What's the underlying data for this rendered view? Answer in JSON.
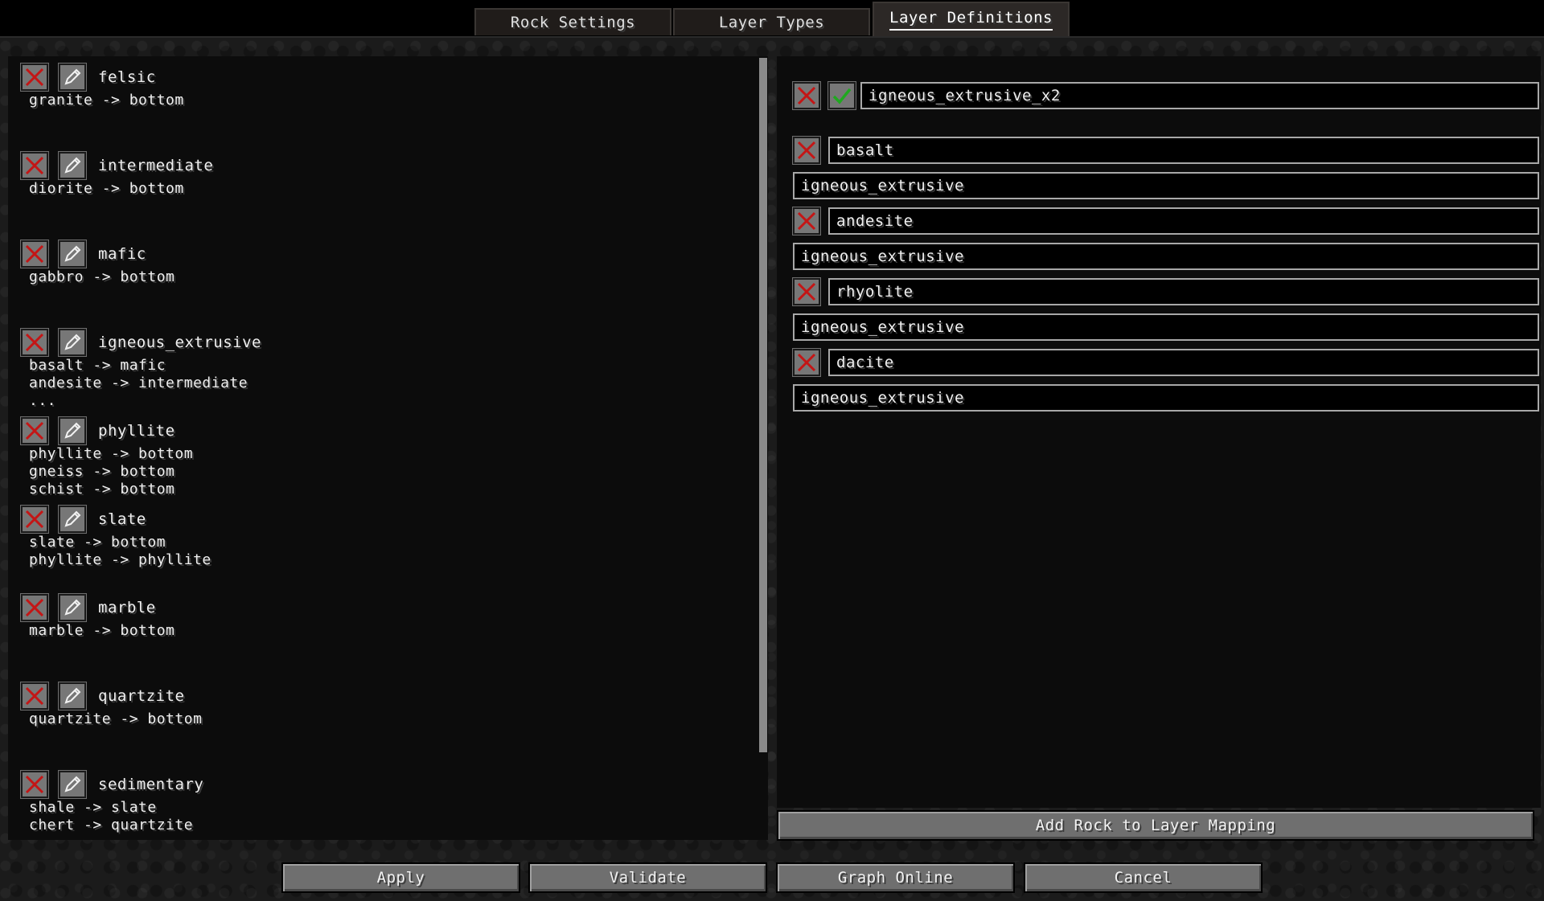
{
  "tabs": [
    {
      "label": "Rock Settings",
      "active": false
    },
    {
      "label": "Layer Types",
      "active": false
    },
    {
      "label": "Layer Definitions",
      "active": true
    }
  ],
  "layers": [
    {
      "name": "felsic",
      "lines": [
        "granite -> bottom"
      ]
    },
    {
      "name": "intermediate",
      "lines": [
        "diorite -> bottom"
      ]
    },
    {
      "name": "mafic",
      "lines": [
        "gabbro -> bottom"
      ]
    },
    {
      "name": "igneous_extrusive",
      "lines": [
        "basalt -> mafic",
        "andesite -> intermediate",
        "..."
      ]
    },
    {
      "name": "phyllite",
      "lines": [
        "phyllite -> bottom",
        "gneiss -> bottom",
        "schist -> bottom"
      ]
    },
    {
      "name": "slate",
      "lines": [
        "slate -> bottom",
        "phyllite -> phyllite"
      ]
    },
    {
      "name": "marble",
      "lines": [
        "marble -> bottom"
      ]
    },
    {
      "name": "quartzite",
      "lines": [
        "quartzite -> bottom"
      ]
    },
    {
      "name": "sedimentary",
      "lines": [
        "shale -> slate",
        "chert -> quartzite"
      ]
    }
  ],
  "editor": {
    "layer_name": "igneous_extrusive_x2",
    "mappings": [
      {
        "rock": "basalt",
        "target": "igneous_extrusive"
      },
      {
        "rock": "andesite",
        "target": "igneous_extrusive"
      },
      {
        "rock": "rhyolite",
        "target": "igneous_extrusive"
      },
      {
        "rock": "dacite",
        "target": "igneous_extrusive"
      }
    ],
    "add_mapping_label": "Add Rock to Layer Mapping"
  },
  "footer": {
    "apply_label": "Apply",
    "validate_label": "Validate",
    "graph_label": "Graph Online",
    "cancel_label": "Cancel"
  },
  "icons": {
    "delete": "close-x-icon",
    "edit": "pencil-icon",
    "confirm": "check-icon"
  },
  "colors": {
    "delete_red": "#c41515",
    "confirm_green": "#1fa81f",
    "button_gray": "#6f6f6f"
  }
}
